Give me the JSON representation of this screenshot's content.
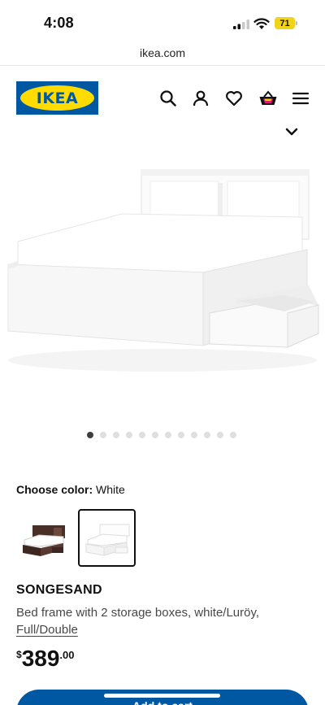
{
  "status_bar": {
    "time": "4:08",
    "battery": "71"
  },
  "browser": {
    "url": "ikea.com"
  },
  "header": {
    "logo_text": "IKEA",
    "icons": [
      "search-icon",
      "profile-icon",
      "heart-icon",
      "basket-icon",
      "menu-icon"
    ]
  },
  "gallery": {
    "total_images": 12,
    "active_index": 0
  },
  "color": {
    "label": "Choose color:",
    "value": "White"
  },
  "product": {
    "name": "SONGESAND",
    "description": "Bed frame with 2 storage boxes, white/Luröy,",
    "size": "Full/Double",
    "price_currency": "$",
    "price_main": "389",
    "price_cents": ".00"
  },
  "cta": {
    "label": "Add to cart"
  },
  "colors": {
    "ikea_blue": "#0058a3",
    "ikea_yellow": "#ffdb00",
    "battery": "#f2d31b"
  }
}
